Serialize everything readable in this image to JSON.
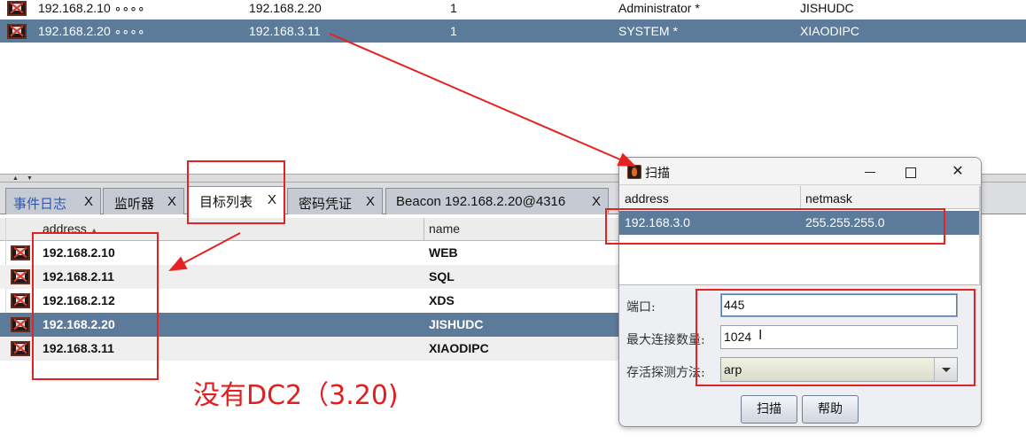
{
  "beacons": [
    {
      "external": "192.168.2.10 ∘∘∘∘",
      "internal": "192.168.2.20",
      "pid": "1",
      "user": "Administrator *",
      "computer": "JISHUDC"
    },
    {
      "external": "192.168.2.20 ∘∘∘∘",
      "internal": "192.168.3.11",
      "pid": "1",
      "user": "SYSTEM *",
      "computer": "XIAODIPC"
    }
  ],
  "tabs": [
    {
      "label": "事件日志",
      "close": "X"
    },
    {
      "label": "监听器",
      "close": "X"
    },
    {
      "label": "目标列表",
      "close": "X"
    },
    {
      "label": "密码凭证",
      "close": "X"
    },
    {
      "label": "Beacon 192.168.2.20@4316",
      "close": "X"
    }
  ],
  "targets": {
    "columns": {
      "address": "address",
      "name": "name"
    },
    "rows": [
      {
        "address": "192.168.2.10",
        "name": "WEB"
      },
      {
        "address": "192.168.2.11",
        "name": "SQL"
      },
      {
        "address": "192.168.2.12",
        "name": "XDS"
      },
      {
        "address": "192.168.2.20",
        "name": "JISHUDC"
      },
      {
        "address": "192.168.3.11",
        "name": "XIAODIPC"
      }
    ]
  },
  "scan_dialog": {
    "title": "扫描",
    "window_controls": {
      "min": "",
      "max": "",
      "close": "✕"
    },
    "columns": {
      "address": "address",
      "netmask": "netmask"
    },
    "rows": [
      {
        "address": "192.168.3.0",
        "netmask": "255.255.255.0"
      }
    ],
    "fields": {
      "port_label": "端口:",
      "port_value": "445",
      "maxconn_label": "最大连接数量:",
      "maxconn_value": "1024",
      "method_label": "存活探测方法:",
      "method_value": "arp"
    },
    "buttons": {
      "scan": "扫描",
      "help": "帮助"
    }
  },
  "annotation": {
    "text": "没有DC2（3.20)",
    "color": "#e02020"
  },
  "colors": {
    "selection": "#5c7b9b",
    "annotation_red": "#e52222"
  }
}
